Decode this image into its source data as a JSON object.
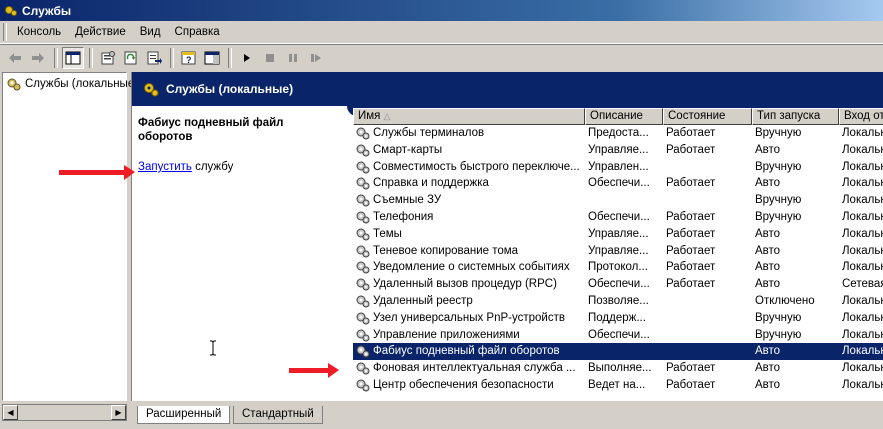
{
  "window": {
    "title": "Службы",
    "icon": "services-gear-icon"
  },
  "menu": [
    "Консоль",
    "Действие",
    "Вид",
    "Справка"
  ],
  "tree": {
    "root_label": "Службы (локальные"
  },
  "pane_header": {
    "title": "Службы (локальные)"
  },
  "extended": {
    "selected_service": "Фабиус подневный файл оборотов",
    "start_link": "Запустить",
    "start_suffix": " службу"
  },
  "columns": [
    "Имя",
    "Описание",
    "Состояние",
    "Тип запуска",
    "Вход от"
  ],
  "rows": [
    {
      "name": "Службы терминалов",
      "desc": "Предоста...",
      "state": "Работает",
      "startup": "Вручную",
      "logon": "Локальн"
    },
    {
      "name": "Смарт-карты",
      "desc": "Управляе...",
      "state": "Работает",
      "startup": "Авто",
      "logon": "Локальн"
    },
    {
      "name": "Совместимость быстрого переключе...",
      "desc": "Управлен...",
      "state": "",
      "startup": "Вручную",
      "logon": "Локальн"
    },
    {
      "name": "Справка и поддержка",
      "desc": "Обеспечи...",
      "state": "Работает",
      "startup": "Авто",
      "logon": "Локальн"
    },
    {
      "name": "Съемные ЗУ",
      "desc": "",
      "state": "",
      "startup": "Вручную",
      "logon": "Локальн"
    },
    {
      "name": "Телефония",
      "desc": "Обеспечи...",
      "state": "Работает",
      "startup": "Вручную",
      "logon": "Локальн"
    },
    {
      "name": "Темы",
      "desc": "Управляе...",
      "state": "Работает",
      "startup": "Авто",
      "logon": "Локальн"
    },
    {
      "name": "Теневое копирование тома",
      "desc": "Управляе...",
      "state": "Работает",
      "startup": "Авто",
      "logon": "Локальн"
    },
    {
      "name": "Уведомление о системных событиях",
      "desc": "Протокол...",
      "state": "Работает",
      "startup": "Авто",
      "logon": "Локальн"
    },
    {
      "name": "Удаленный вызов процедур (RPC)",
      "desc": "Обеспечи...",
      "state": "Работает",
      "startup": "Авто",
      "logon": "Сетевая"
    },
    {
      "name": "Удаленный реестр",
      "desc": "Позволяе...",
      "state": "",
      "startup": "Отключено",
      "logon": "Локальн"
    },
    {
      "name": "Узел универсальных PnP-устройств",
      "desc": "Поддерж...",
      "state": "",
      "startup": "Вручную",
      "logon": "Локальн"
    },
    {
      "name": "Управление приложениями",
      "desc": "Обеспечи...",
      "state": "",
      "startup": "Вручную",
      "logon": "Локальн"
    },
    {
      "name": "Фабиус подневный файл оборотов",
      "desc": "",
      "state": "",
      "startup": "Авто",
      "logon": "Локальн",
      "selected": true
    },
    {
      "name": "Фоновая интеллектуальная служба ...",
      "desc": "Выполняе...",
      "state": "Работает",
      "startup": "Авто",
      "logon": "Локальн"
    },
    {
      "name": "Центр обеспечения безопасности",
      "desc": "Ведет на...",
      "state": "Работает",
      "startup": "Авто",
      "logon": "Локальн"
    }
  ],
  "tabs": [
    "Расширенный",
    "Стандартный"
  ],
  "colors": {
    "title_blue": "#0a246a",
    "selection": "#0a246a",
    "annotation_arrow": "#ee1c25",
    "link": "#0000ee"
  }
}
